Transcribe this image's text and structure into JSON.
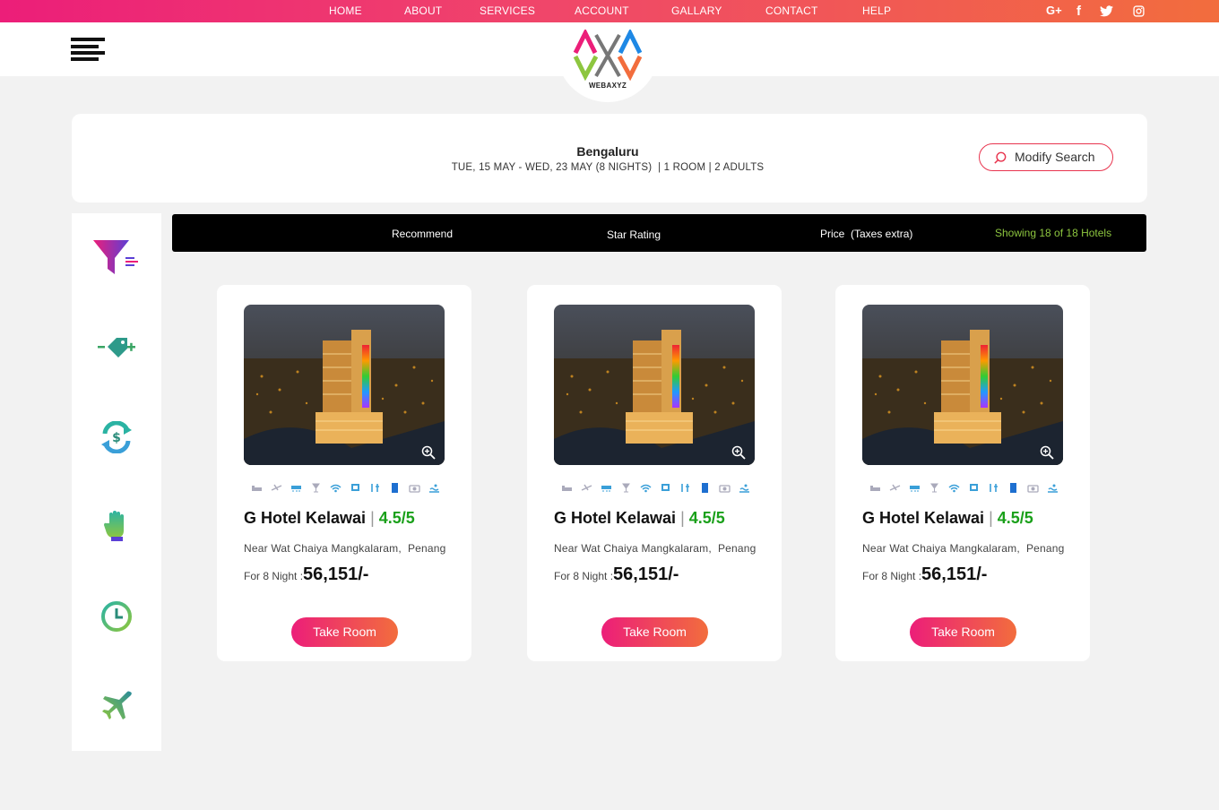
{
  "nav": {
    "items": [
      "HOME",
      "ABOUT",
      "SERVICES",
      "ACCOUNT",
      "GALLARY",
      "CONTACT",
      "HELP"
    ],
    "social": [
      "google-plus-icon",
      "facebook-icon",
      "twitter-icon",
      "instagram-icon"
    ]
  },
  "brand": {
    "logo_text": "WEBAXYZ"
  },
  "search": {
    "city": "Bengaluru",
    "details": "TUE, 15 MAY - WED, 23 MAY (8 NIGHTS)  | 1 ROOM | 2 ADULTS",
    "modify_label": "Modify Search"
  },
  "sidebar": {
    "icons": [
      "filter-icon",
      "price-tag-icon",
      "refund-icon",
      "hand-icon",
      "clock-icon",
      "flight-icon"
    ]
  },
  "sort": {
    "recommend": "Recommend",
    "star_rating": "Star Rating",
    "price": "Price  (Taxes extra)",
    "showing": "Showing 18 of 18 Hotels"
  },
  "hotels": [
    {
      "name": "G Hotel Kelawai",
      "rating": "4.5/5",
      "address": "Near Wat Chaiya Mangkalaram,  Penang",
      "price_label": "For 8 Night :",
      "price": "56,151/-",
      "cta": "Take Room"
    },
    {
      "name": "G Hotel Kelawai",
      "rating": "4.5/5",
      "address": "Near Wat Chaiya Mangkalaram,  Penang",
      "price_label": "For 8 Night :",
      "price": "56,151/-",
      "cta": "Take Room"
    },
    {
      "name": "G Hotel Kelawai",
      "rating": "4.5/5",
      "address": "Near Wat Chaiya Mangkalaram,  Penang",
      "price_label": "For 8 Night :",
      "price": "56,151/-",
      "cta": "Take Room"
    }
  ],
  "colors": {
    "brand_pink": "#ec1e79",
    "brand_orange": "#f26d3d",
    "rating_green": "#1aa01a",
    "count_green": "#8dc63f"
  }
}
